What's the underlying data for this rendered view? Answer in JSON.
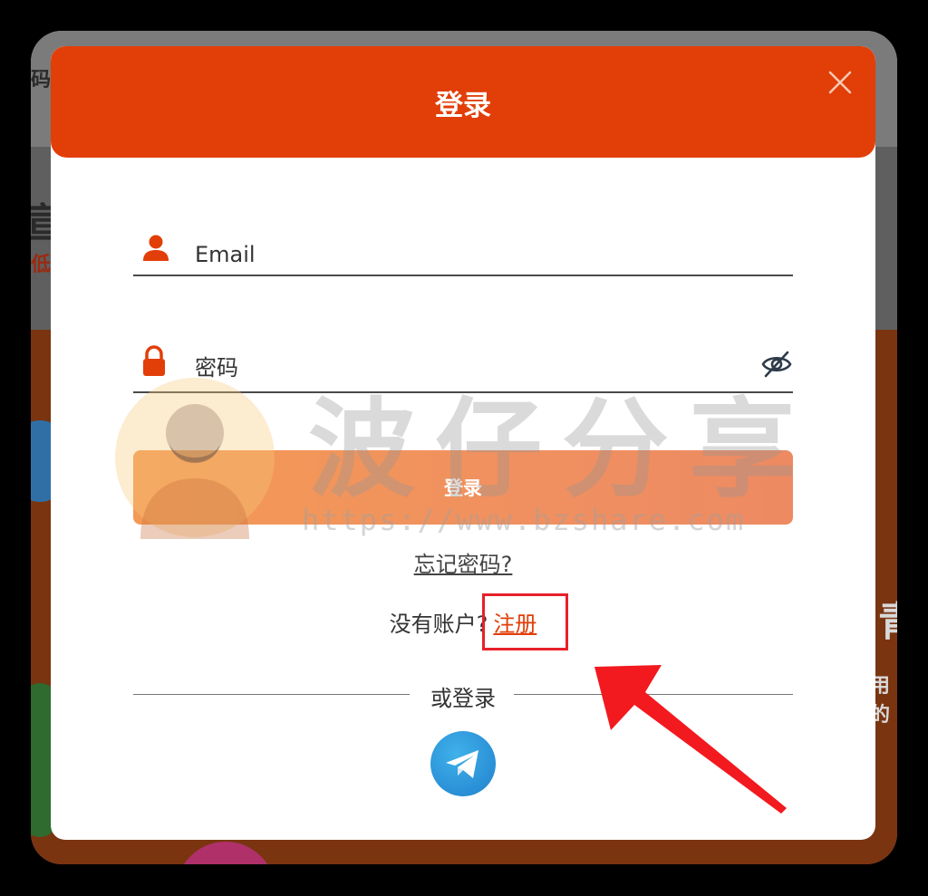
{
  "background": {
    "fragments": [
      "码",
      "宣",
      "低的",
      "青",
      "用的"
    ]
  },
  "modal": {
    "title": "登录",
    "email": {
      "placeholder": "Email"
    },
    "password": {
      "placeholder": "密码"
    },
    "login_button": "登录",
    "forgot_link": "忘记密码?",
    "signup": {
      "prompt": "没有账户?",
      "link": "注册"
    },
    "divider": "或登录"
  },
  "watermark": {
    "text": "波仔分享",
    "url": "https://www.bzshare.com"
  },
  "icons": {
    "close": "close-icon",
    "user": "user-icon",
    "lock": "lock-icon",
    "eye": "eye-slash-icon",
    "telegram": "telegram-icon",
    "arrow": "arrow-annotation"
  },
  "colors": {
    "header": "#e23e08",
    "button_gradient_start": "#f39a56",
    "button_gradient_end": "#ed8a62",
    "link": "#e23e08",
    "highlight": "#e8202a",
    "telegram": "#2a8fd6"
  }
}
